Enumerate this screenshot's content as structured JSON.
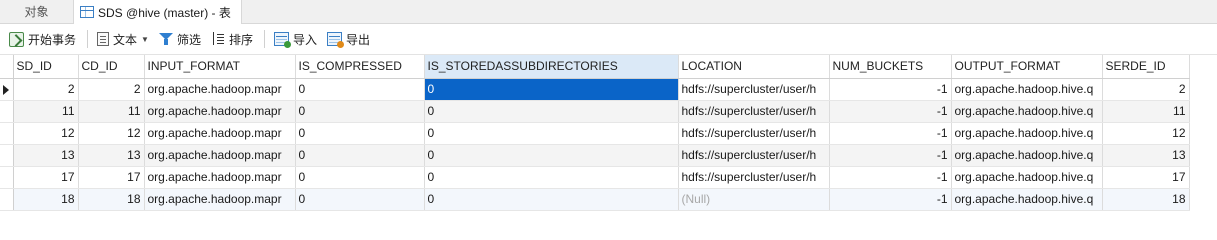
{
  "tabs": [
    {
      "label": "对象"
    },
    {
      "label": "SDS @hive (master) - 表"
    }
  ],
  "toolbar": {
    "begin_txn": "开始事务",
    "text": "文本",
    "filter": "筛选",
    "sort": "排序",
    "import": "导入",
    "export": "导出"
  },
  "columns": [
    "SD_ID",
    "CD_ID",
    "INPUT_FORMAT",
    "IS_COMPRESSED",
    "IS_STOREDASSUBDIRECTORIES",
    "LOCATION",
    "NUM_BUCKETS",
    "OUTPUT_FORMAT",
    "SERDE_ID"
  ],
  "rows": [
    [
      "2",
      "2",
      "org.apache.hadoop.mapr",
      "0",
      "0",
      "hdfs://supercluster/user/h",
      "-1",
      "org.apache.hadoop.hive.q",
      "2"
    ],
    [
      "11",
      "11",
      "org.apache.hadoop.mapr",
      "0",
      "0",
      "hdfs://supercluster/user/h",
      "-1",
      "org.apache.hadoop.hive.q",
      "11"
    ],
    [
      "12",
      "12",
      "org.apache.hadoop.mapr",
      "0",
      "0",
      "hdfs://supercluster/user/h",
      "-1",
      "org.apache.hadoop.hive.q",
      "12"
    ],
    [
      "13",
      "13",
      "org.apache.hadoop.mapr",
      "0",
      "0",
      "hdfs://supercluster/user/h",
      "-1",
      "org.apache.hadoop.hive.q",
      "13"
    ],
    [
      "17",
      "17",
      "org.apache.hadoop.mapr",
      "0",
      "0",
      "hdfs://supercluster/user/h",
      "-1",
      "org.apache.hadoop.hive.q",
      "17"
    ],
    [
      "18",
      "18",
      "org.apache.hadoop.mapr",
      "0",
      "0",
      "(Null)",
      "-1",
      "org.apache.hadoop.hive.q",
      "18"
    ]
  ],
  "colors": {
    "selection": "#0a64c8",
    "header_selected": "#dbe9f7",
    "null_text": "#a8a8a8"
  }
}
